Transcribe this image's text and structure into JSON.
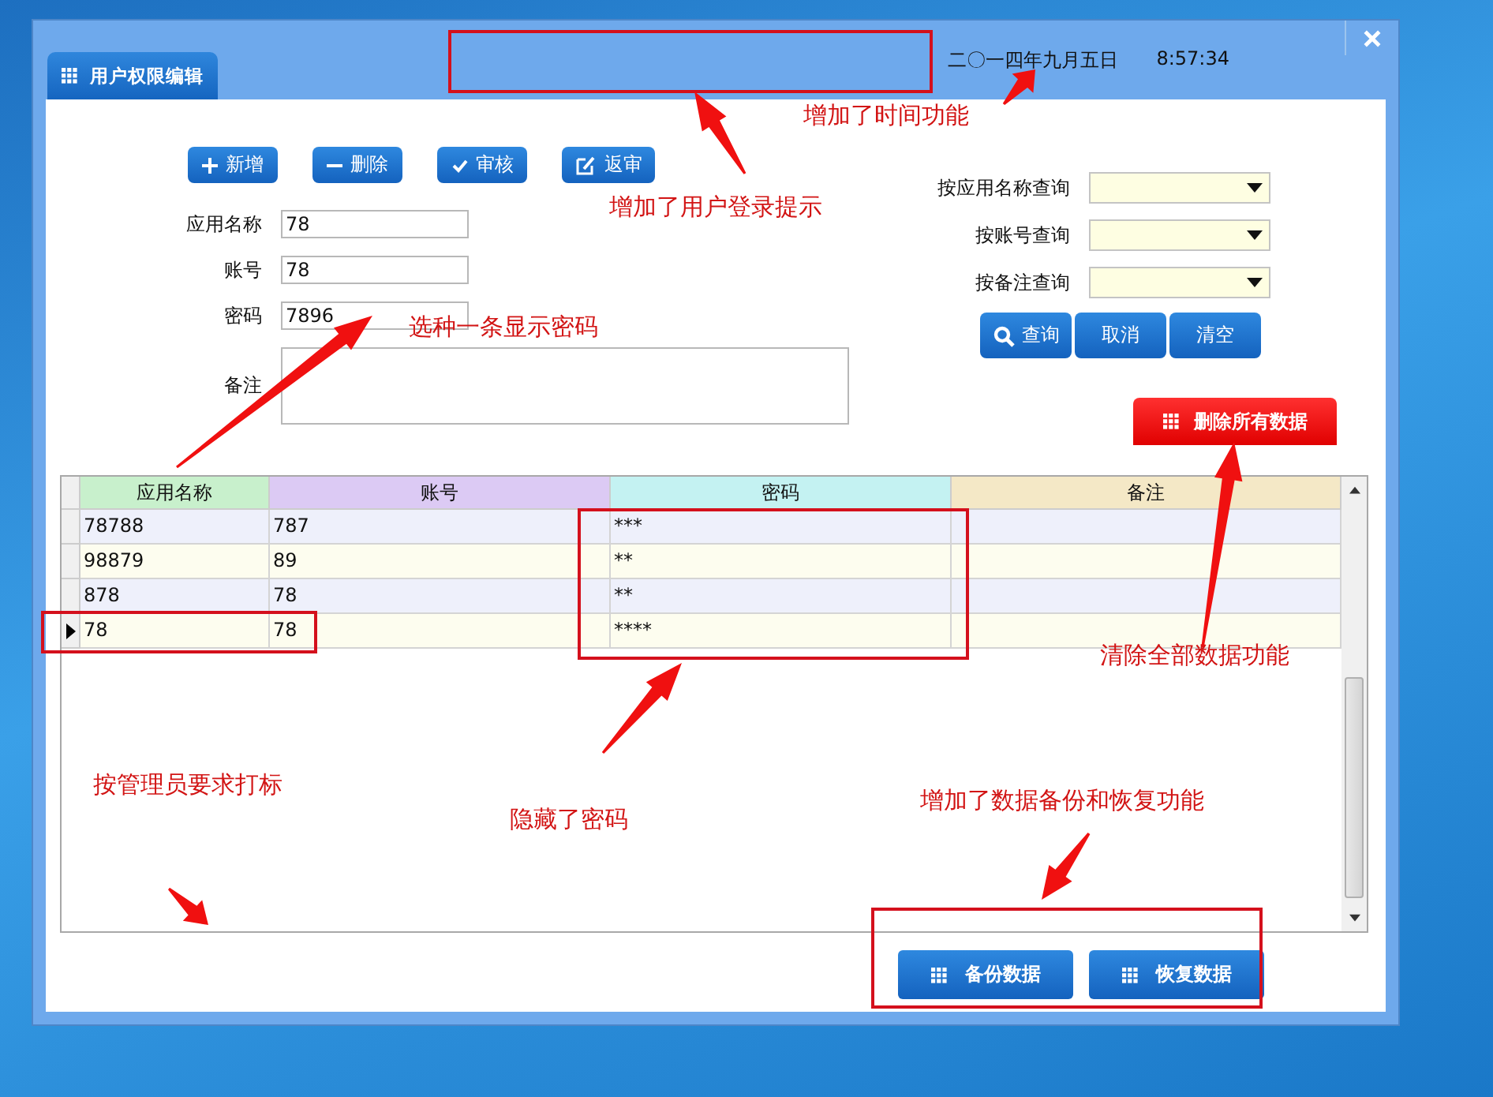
{
  "window": {
    "tab": "用户权限编辑",
    "date": "二〇一四年九月五日",
    "time": "8:57:34"
  },
  "toolbar": [
    {
      "label": "新增",
      "kind": "add"
    },
    {
      "label": "删除",
      "kind": "remove"
    },
    {
      "label": "审核",
      "kind": "approve"
    },
    {
      "label": "返审",
      "kind": "edit"
    }
  ],
  "form": [
    {
      "label": "应用名称",
      "value": "78"
    },
    {
      "label": "账号",
      "value": "78"
    },
    {
      "label": "密码",
      "value": "7896"
    },
    {
      "label": "备注",
      "kind": "multiline"
    }
  ],
  "query": {
    "fields": [
      {
        "label": "按应用名称查询"
      },
      {
        "label": "按账号查询"
      },
      {
        "label": "按备注查询"
      }
    ],
    "buttons": [
      {
        "label": "查询",
        "kind": "search"
      },
      {
        "label": "取消"
      },
      {
        "label": "清空"
      }
    ],
    "delete_all": "删除所有数据"
  },
  "table": {
    "columns": [
      {
        "label": "应用名称",
        "color": "#c8f0cc"
      },
      {
        "label": "账号",
        "color": "#dccaf4"
      },
      {
        "label": "密码",
        "color": "#c4f2f2"
      },
      {
        "label": "备注",
        "color": "#f4e8c6"
      }
    ],
    "rows": [
      {
        "cells": [
          "78788",
          "787",
          "***",
          ""
        ],
        "selected": false
      },
      {
        "cells": [
          "98879",
          "89",
          "**",
          ""
        ],
        "selected": false
      },
      {
        "cells": [
          "878",
          "78",
          "**",
          ""
        ],
        "selected": false
      },
      {
        "cells": [
          "78",
          "78",
          "****",
          ""
        ],
        "selected": true
      }
    ]
  },
  "footer_buttons": [
    "备份数据",
    "恢复数据"
  ],
  "annotations": [
    "增加了时间功能",
    "增加了用户登录提示",
    "选种一条显示密码",
    "清除全部数据功能",
    "按管理员要求打标",
    "隐藏了密码",
    "增加了数据备份和恢复功能"
  ]
}
